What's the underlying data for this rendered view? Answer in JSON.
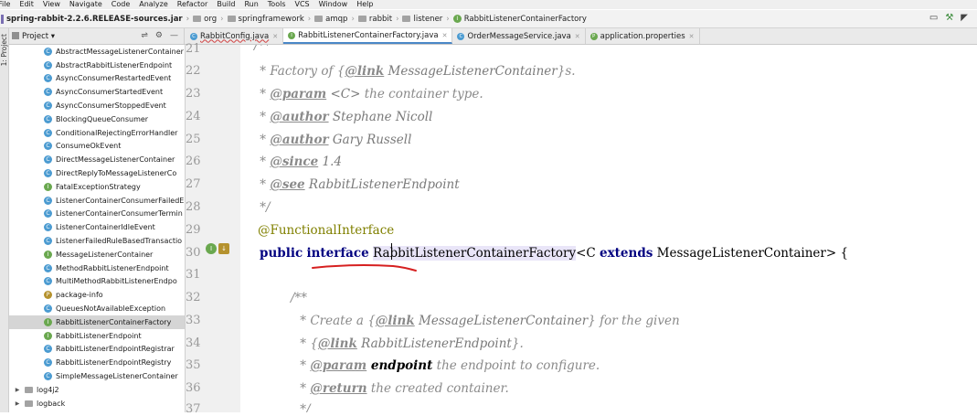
{
  "menu": [
    "File",
    "Edit",
    "View",
    "Navigate",
    "Code",
    "Analyze",
    "Refactor",
    "Build",
    "Run",
    "Tools",
    "VCS",
    "Window",
    "Help"
  ],
  "breadcrumb": {
    "jar": "spring-rabbit-2.2.6.RELEASE-sources.jar",
    "folders": [
      "org",
      "springframework",
      "amqp",
      "rabbit",
      "listener"
    ],
    "file": "RabbitListenerContainerFactory"
  },
  "project": {
    "label": "Project",
    "side_label": "1: Project",
    "items": [
      {
        "name": "AbstractMessageListenerContainer",
        "kind": "c"
      },
      {
        "name": "AbstractRabbitListenerEndpoint",
        "kind": "c"
      },
      {
        "name": "AsyncConsumerRestartedEvent",
        "kind": "c"
      },
      {
        "name": "AsyncConsumerStartedEvent",
        "kind": "c"
      },
      {
        "name": "AsyncConsumerStoppedEvent",
        "kind": "c"
      },
      {
        "name": "BlockingQueueConsumer",
        "kind": "c"
      },
      {
        "name": "ConditionalRejectingErrorHandler",
        "kind": "c"
      },
      {
        "name": "ConsumeOkEvent",
        "kind": "c"
      },
      {
        "name": "DirectMessageListenerContainer",
        "kind": "c"
      },
      {
        "name": "DirectReplyToMessageListenerCo",
        "kind": "c"
      },
      {
        "name": "FatalExceptionStrategy",
        "kind": "i"
      },
      {
        "name": "ListenerContainerConsumerFailedE",
        "kind": "c"
      },
      {
        "name": "ListenerContainerConsumerTermin",
        "kind": "c"
      },
      {
        "name": "ListenerContainerIdleEvent",
        "kind": "c"
      },
      {
        "name": "ListenerFailedRuleBasedTransactio",
        "kind": "c"
      },
      {
        "name": "MessageListenerContainer",
        "kind": "i"
      },
      {
        "name": "MethodRabbitListenerEndpoint",
        "kind": "c"
      },
      {
        "name": "MultiMethodRabbitListenerEndpo",
        "kind": "c"
      },
      {
        "name": "package-info",
        "kind": "e"
      },
      {
        "name": "QueuesNotAvailableException",
        "kind": "c"
      },
      {
        "name": "RabbitListenerContainerFactory",
        "kind": "i",
        "selected": true
      },
      {
        "name": "RabbitListenerEndpoint",
        "kind": "i"
      },
      {
        "name": "RabbitListenerEndpointRegistrar",
        "kind": "c"
      },
      {
        "name": "RabbitListenerEndpointRegistry",
        "kind": "c"
      },
      {
        "name": "SimpleMessageListenerContainer",
        "kind": "c"
      }
    ],
    "folders": [
      "log4j2",
      "logback"
    ]
  },
  "tabs": [
    {
      "label": "RabbitConfig.java",
      "icon": "c",
      "active": false
    },
    {
      "label": "RabbitListenerContainerFactory.java",
      "icon": "i",
      "active": true
    },
    {
      "label": "OrderMessageService.java",
      "icon": "c",
      "active": false
    },
    {
      "label": "application.properties",
      "icon": "p",
      "active": false
    }
  ],
  "line_numbers": [
    "21",
    "22",
    "23",
    "24",
    "25",
    "26",
    "27",
    "28",
    "29",
    "30",
    "31",
    "32",
    "33",
    "34",
    "35",
    "36",
    "37"
  ],
  "code": {
    "l21": "/**",
    "l22_pre": " * Factory of {",
    "l22_tag": "@link",
    "l22_ref": " MessageListenerContainer",
    "l22_post": "}s.",
    "l23_pre": " * ",
    "l23_tag": "@param",
    "l23_ref": " <C>",
    "l23_post": " the container type.",
    "l24_tag": "@author",
    "l24_ref": " Stephane Nicoll",
    "l25_tag": "@author",
    "l25_ref": " Gary Russell",
    "l26_tag": "@since",
    "l26_ref": " 1.4",
    "l27_tag": "@see",
    "l27_ref": " RabbitListenerEndpoint",
    "l28": " */",
    "l29": "@FunctionalInterface",
    "l30_kw1": "public",
    "l30_kw2": "interface",
    "l30_name": "RabbitListenerContainerFactory",
    "l30_gen1": "<C ",
    "l30_kw3": "extends",
    "l30_rest": " MessageListenerContainer> {",
    "l32": "/**",
    "l33_pre": " * Create a {",
    "l33_tag": "@link",
    "l33_ref": " MessageListenerContainer",
    "l33_post": "} for the given",
    "l34_pre": " * {",
    "l34_tag": "@link",
    "l34_ref": " RabbitListenerEndpoint",
    "l34_post": "}.",
    "l35_tag": "@param",
    "l35_ref": " endpoint",
    "l35_post": " the endpoint to configure.",
    "l36_tag": "@return",
    "l36_post": " the created container.",
    "l37": " */"
  },
  "colors": {
    "accent": "#4a88c7",
    "annotation_red": "#d62020",
    "keyword": "#000080"
  }
}
